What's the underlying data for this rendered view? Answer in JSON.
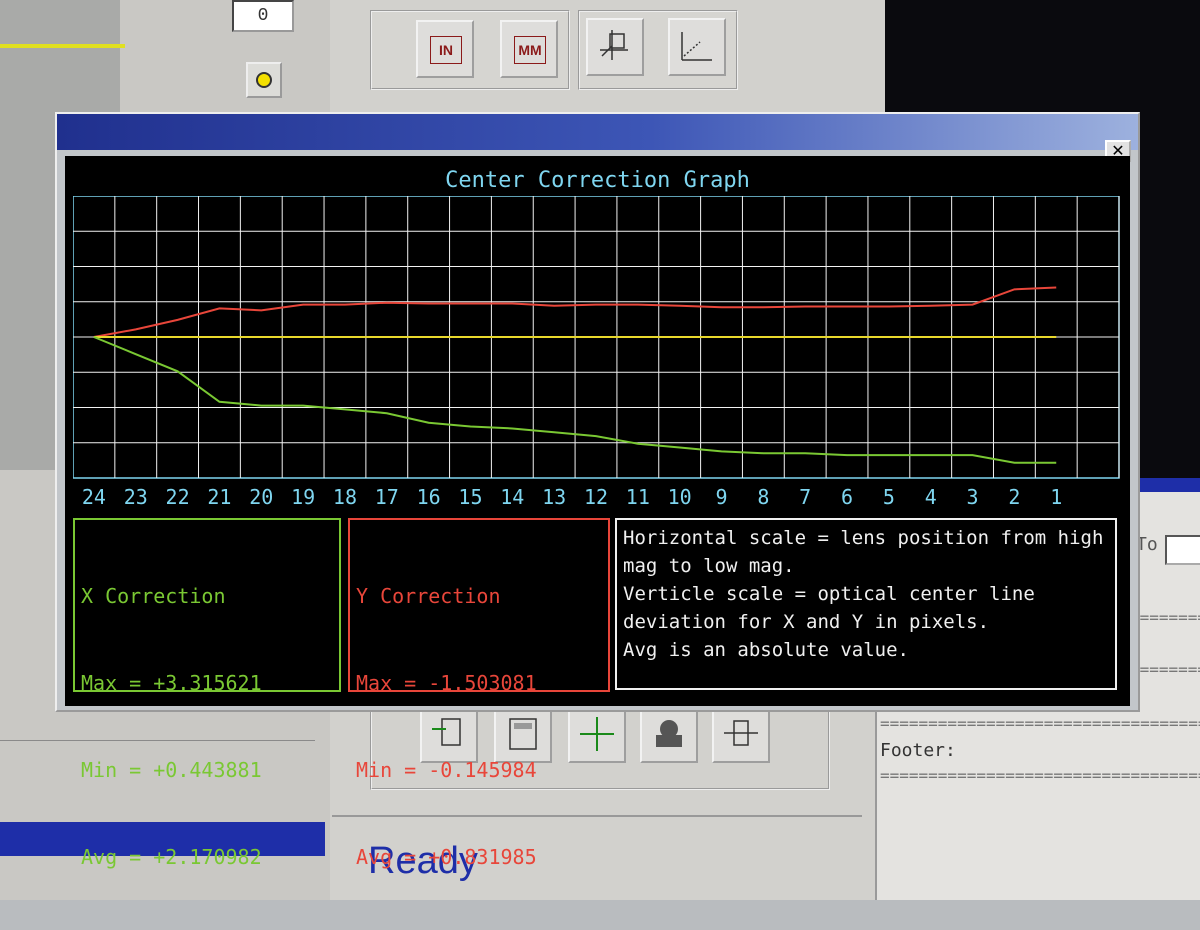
{
  "background": {
    "number_field_value": "0",
    "unit_buttons": [
      "IN",
      "MM"
    ],
    "status_text": "Ready",
    "right_panel": {
      "to_label": "To",
      "footer_label": "Footer:",
      "separator": "==================================="
    }
  },
  "dialog": {
    "close_label": "✕",
    "graph_title": "Center Correction Graph",
    "x_panel": {
      "title": "X Correction",
      "max": "Max = +3.315621",
      "min": "Min = +0.443881",
      "avg": "Avg = +2.170982"
    },
    "y_panel": {
      "title": "Y Correction",
      "max": "Max = -1.503081",
      "min": "Min = -0.145984",
      "avg": "Avg = +0.831985"
    },
    "note": {
      "line1": "Horizontal scale = lens position from high mag to low mag.",
      "line2": "Verticle scale = optical center line deviation for X and Y in pixels.",
      "line3": "Avg is an absolute value."
    }
  },
  "colors": {
    "x_series": "#7ac833",
    "y_series": "#e8463a",
    "center_line": "#e8d82c",
    "grid": "#f2f2f2",
    "frame": "#7fd6f0",
    "tick_labels": "#7fd6f0"
  },
  "chart_data": {
    "type": "line",
    "title": "Center Correction Graph",
    "xlabel": "",
    "ylabel": "",
    "x": [
      24,
      23,
      22,
      21,
      20,
      19,
      18,
      17,
      16,
      15,
      14,
      13,
      12,
      11,
      10,
      9,
      8,
      7,
      6,
      5,
      4,
      3,
      2,
      1
    ],
    "ylim": [
      -3.7,
      3.7
    ],
    "grid": true,
    "series": [
      {
        "name": "Y Correction",
        "color": "#e8463a",
        "values": [
          0.0,
          -0.2,
          -0.45,
          -0.75,
          -0.7,
          -0.85,
          -0.85,
          -0.9,
          -0.88,
          -0.88,
          -0.88,
          -0.82,
          -0.85,
          -0.85,
          -0.82,
          -0.78,
          -0.78,
          -0.8,
          -0.8,
          -0.8,
          -0.82,
          -0.85,
          -1.25,
          -1.3
        ]
      },
      {
        "name": "",
        "color": "#e8d82c",
        "values": [
          0,
          0,
          0,
          0,
          0,
          0,
          0,
          0,
          0,
          0,
          0,
          0,
          0,
          0,
          0,
          0,
          0,
          0,
          0,
          0,
          0,
          0,
          0,
          0
        ]
      },
      {
        "name": "X Correction",
        "color": "#7ac833",
        "values": [
          0.0,
          0.45,
          0.9,
          1.7,
          1.8,
          1.8,
          1.9,
          2.0,
          2.25,
          2.35,
          2.4,
          2.5,
          2.6,
          2.8,
          2.9,
          3.0,
          3.05,
          3.05,
          3.1,
          3.1,
          3.1,
          3.1,
          3.3,
          3.3
        ]
      }
    ]
  }
}
